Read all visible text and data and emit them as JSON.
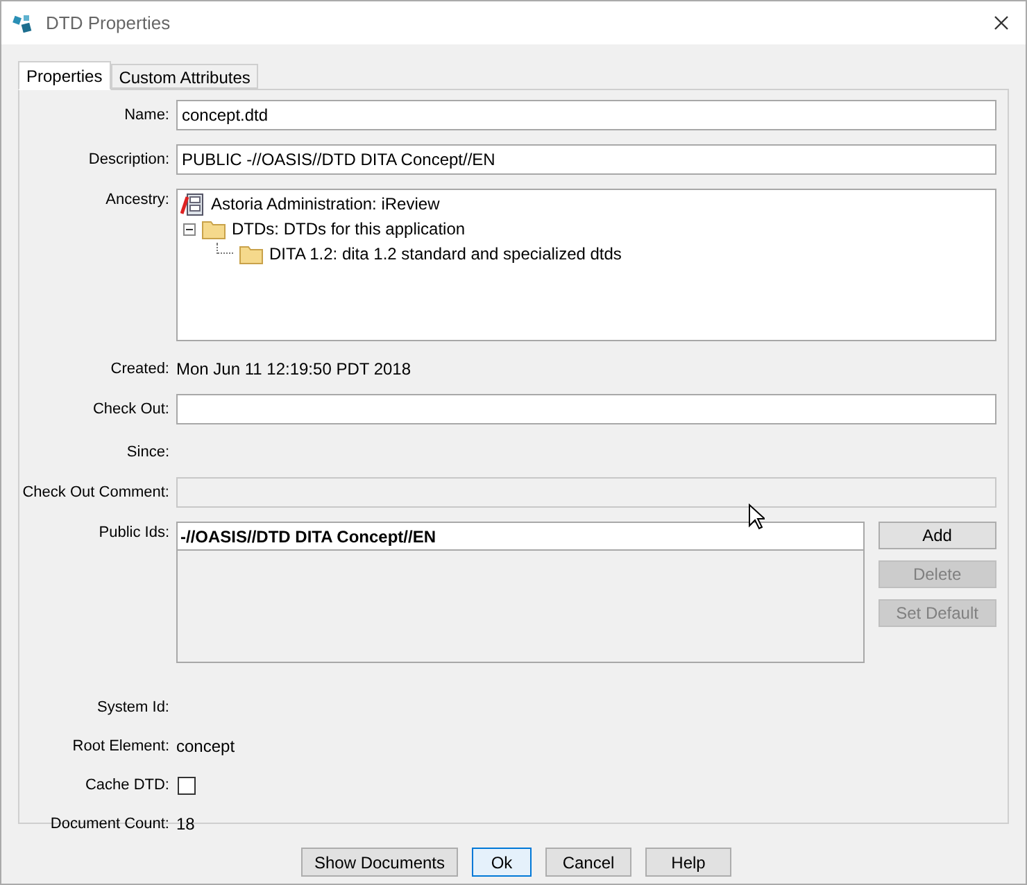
{
  "window": {
    "title": "DTD Properties"
  },
  "tabs": [
    {
      "label": "Properties",
      "selected": true
    },
    {
      "label": "Custom Attributes",
      "selected": false
    }
  ],
  "fields": [
    {
      "kind": "input",
      "label": "Name:",
      "value": "concept.dtd",
      "disabled": false
    },
    {
      "kind": "input",
      "label": "Description:",
      "value": "PUBLIC -//OASIS//DTD DITA Concept//EN",
      "disabled": false
    },
    {
      "kind": "tree",
      "label": "Ancestry:",
      "tree": [
        {
          "label": "Astoria Administration: iReview",
          "kind": "app",
          "children": [
            {
              "label": "DTDs: DTDs for this application",
              "kind": "folder",
              "expanded": true,
              "children": [
                {
                  "label": "DITA 1.2: dita 1.2 standard and specialized dtds",
                  "kind": "folder"
                }
              ]
            }
          ]
        }
      ]
    },
    {
      "kind": "text",
      "label": "Created:",
      "value": "Mon Jun 11 12:19:50 PDT 2018"
    },
    {
      "kind": "input",
      "label": "Check Out:",
      "disabled": false
    },
    {
      "kind": "text",
      "label": "Since:"
    },
    {
      "kind": "input",
      "label": "Check Out Comment:",
      "disabled": true
    },
    {
      "kind": "list",
      "label": "Public Ids:",
      "items": [
        {
          "label": "-//OASIS//DTD DITA Concept//EN",
          "selected": true
        }
      ],
      "buttons": [
        {
          "label": "Add",
          "disabled": false
        },
        {
          "label": "Delete",
          "disabled": true
        },
        {
          "label": "Set Default",
          "disabled": true
        }
      ]
    },
    {
      "kind": "text",
      "label": "System Id:"
    },
    {
      "kind": "text",
      "label": "Root Element:",
      "value": "concept"
    },
    {
      "kind": "checkbox",
      "label": "Cache DTD:",
      "checked": false
    },
    {
      "kind": "text",
      "label": "Document Count:",
      "value": "18"
    }
  ],
  "buttons": [
    {
      "label": "Show Documents",
      "default": false
    },
    {
      "label": "Ok",
      "default": true
    },
    {
      "label": "Cancel",
      "default": false
    },
    {
      "label": "Help",
      "default": false
    }
  ]
}
